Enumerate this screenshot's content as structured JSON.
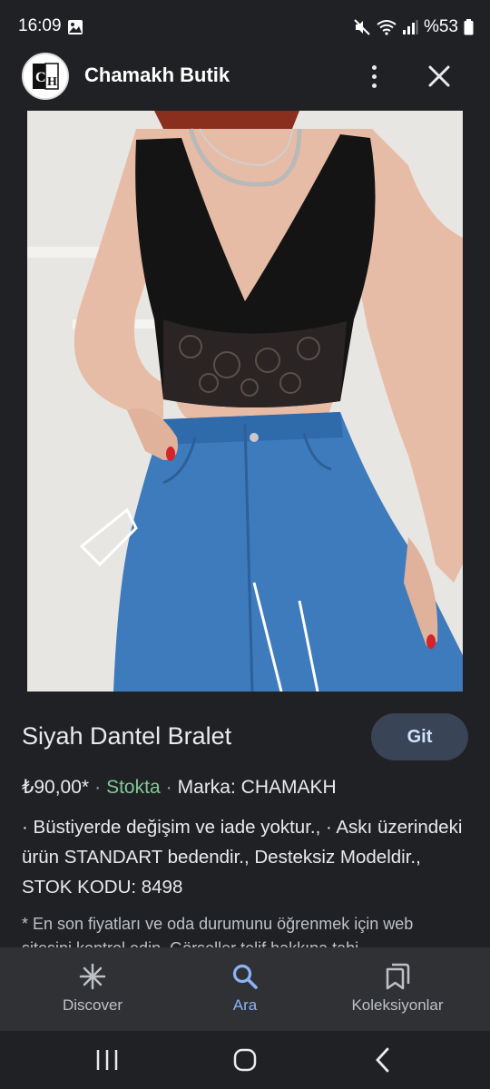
{
  "status_bar": {
    "time": "16:09",
    "battery": "%53"
  },
  "header": {
    "site_name": "Chamakh Butik",
    "avatar_letters": "CH"
  },
  "product": {
    "title": "Siyah Dantel Bralet",
    "go_label": "Git",
    "price": "₺90,00*",
    "availability": "Stokta",
    "brand": "Marka: CHAMAKH",
    "description": "· Büstiyerde değişim ve iade yoktur., · Askı üzerindeki ürün STANDART bedendir., Desteksiz Modeldir., STOK KODU: 8498",
    "disclaimer": "* En son fiyatları ve oda durumunu öğrenmek için web sitesini kontrol edin. Görseller telif hakkına tabi"
  },
  "bottom_nav": {
    "items": [
      {
        "label": "Discover",
        "icon": "asterisk-icon",
        "active": false
      },
      {
        "label": "Ara",
        "icon": "search-icon",
        "active": true
      },
      {
        "label": "Koleksiyonlar",
        "icon": "collections-icon",
        "active": false
      }
    ]
  },
  "colors": {
    "background": "#202124",
    "accent": "#8ab4f8",
    "stock_green": "#81c995",
    "go_button_bg": "#394457"
  }
}
